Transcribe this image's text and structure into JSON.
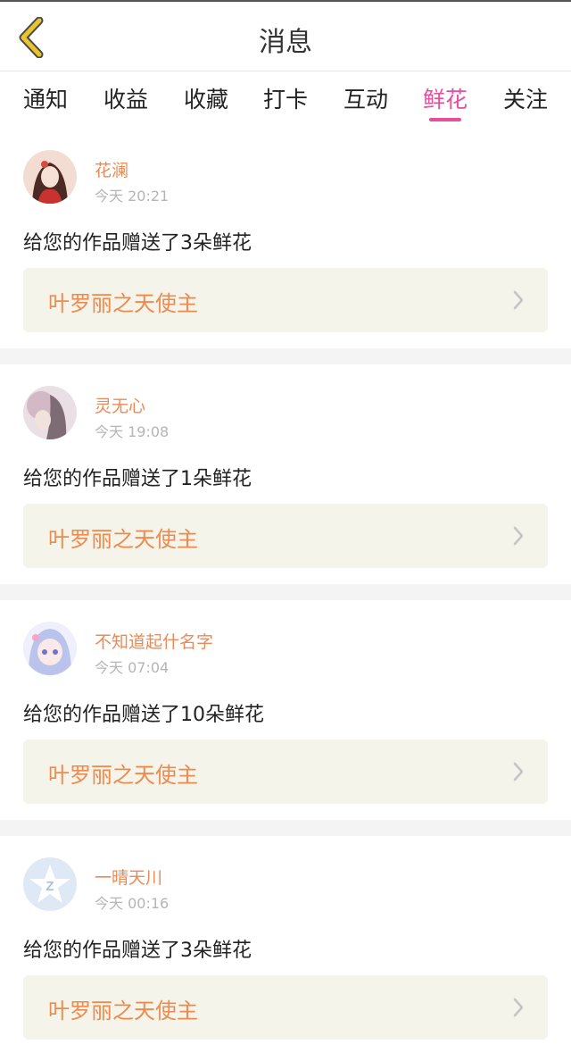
{
  "header": {
    "title": "消息",
    "back_icon": "chevron-left-icon",
    "accent": "#e8c52c"
  },
  "tabs": [
    {
      "label": "通知",
      "active": false
    },
    {
      "label": "收益",
      "active": false
    },
    {
      "label": "收藏",
      "active": false
    },
    {
      "label": "打卡",
      "active": false
    },
    {
      "label": "互动",
      "active": false
    },
    {
      "label": "鲜花",
      "active": true
    },
    {
      "label": "关注",
      "active": false
    }
  ],
  "active_tab_color": "#e84f9a",
  "messages": [
    {
      "user": "花澜",
      "time": "今天 20:21",
      "text": "给您的作品赠送了3朵鲜花",
      "work": "叶罗丽之天使主"
    },
    {
      "user": "灵无心",
      "time": "今天 19:08",
      "text": "给您的作品赠送了1朵鲜花",
      "work": "叶罗丽之天使主"
    },
    {
      "user": "不知道起什名字",
      "time": "今天 07:04",
      "text": "给您的作品赠送了10朵鲜花",
      "work": "叶罗丽之天使主"
    },
    {
      "user": "一晴天川",
      "time": "今天 00:16",
      "text": "给您的作品赠送了3朵鲜花",
      "work": "叶罗丽之天使主"
    }
  ]
}
